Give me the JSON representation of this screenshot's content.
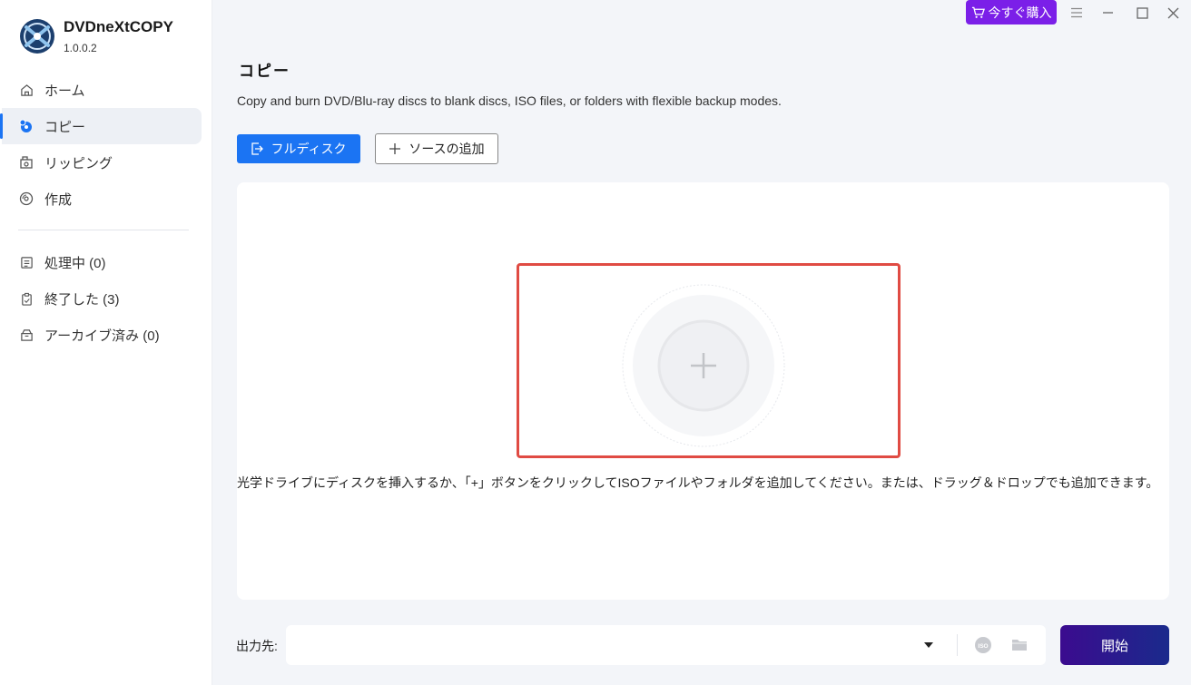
{
  "app": {
    "name": "DVDneXtCOPY",
    "version": "1.0.0.2"
  },
  "sidebar": {
    "items": [
      {
        "label": "ホーム",
        "icon": "home-icon"
      },
      {
        "label": "コピー",
        "icon": "disc-copy-icon",
        "active": true
      },
      {
        "label": "リッピング",
        "icon": "rip-icon"
      },
      {
        "label": "作成",
        "icon": "create-disc-icon"
      }
    ],
    "tasks": [
      {
        "label": "処理中 (0)",
        "icon": "processing-list-icon"
      },
      {
        "label": "終了した (3)",
        "icon": "finished-clipboard-icon"
      },
      {
        "label": "アーカイブ済み (0)",
        "icon": "archive-box-icon"
      }
    ]
  },
  "titlebar": {
    "buy_label": "今すぐ購入"
  },
  "main": {
    "title": "コピー",
    "description": "Copy and burn DVD/Blu-ray discs to blank discs, ISO files, or folders with flexible backup modes.",
    "full_disc_label": "フルディスク",
    "add_source_label": "ソースの追加",
    "drop_hint": "光学ドライブにディスクを挿入するか、「+」ボタンをクリックしてISOファイルやフォルダを追加してください。または、ドラッグ＆ドロップでも追加できます。"
  },
  "output": {
    "label": "出力先:",
    "value": "",
    "iso_icon_text": "ISO",
    "start_label": "開始"
  },
  "colors": {
    "accent": "#1b74f3",
    "buy": "#7b1fe8",
    "highlight": "#e04b43",
    "start_from": "#3b0b8f",
    "start_to": "#1a2a8c"
  }
}
